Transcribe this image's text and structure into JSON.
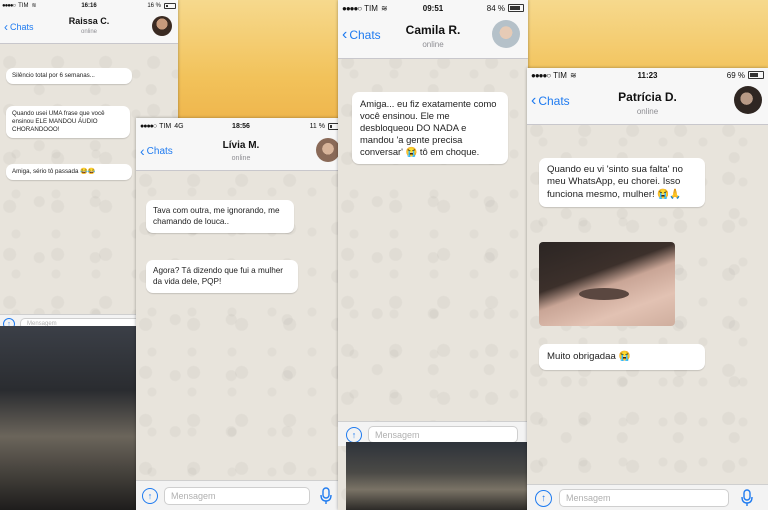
{
  "screens": [
    {
      "status": {
        "carrier": "TIM",
        "time": "16:16",
        "battery": "16 %"
      },
      "nav": {
        "back": "Chats",
        "name": "Raissa C.",
        "status": "online"
      },
      "messages": [
        "Silêncio total por 6 semanas...",
        "Quando usei UMA frase que você ensinou ELE MANDOU ÁUDIO CHORANDOOO!",
        "Amiga, sério tô passada 😂😂"
      ],
      "input_placeholder": "Mensagem"
    },
    {
      "status": {
        "carrier": "TIM",
        "network": "4G",
        "time": "18:56",
        "battery": "11 %"
      },
      "nav": {
        "back": "Chats",
        "name": "Lívia M.",
        "status": "online"
      },
      "messages": [
        "Tava com outra, me ignorando, me chamando de louca..",
        "Agora? Tá dizendo que fui a mulher da vida dele, PQP!"
      ],
      "input_placeholder": "Mensagem"
    },
    {
      "status": {
        "carrier": "TIM",
        "time": "09:51",
        "battery": "84 %"
      },
      "nav": {
        "back": "Chats",
        "name": "Camila R.",
        "status": "online"
      },
      "messages": [
        "Amiga... eu fiz exatamente como você ensinou. Ele me desbloqueou DO NADA e mandou 'a gente precisa conversar' 😭 tô em choque."
      ],
      "input_placeholder": "Mensagem"
    },
    {
      "status": {
        "carrier": "TIM",
        "time": "11:23",
        "battery": "69 %"
      },
      "nav": {
        "back": "Chats",
        "name": "Patrícia D.",
        "status": "online"
      },
      "messages": [
        "Quando eu vi 'sinto sua falta' no meu WhatsApp, eu chorei. Isso funciona mesmo, mulher! 😭🙏",
        "Muito obrigadaa 😭"
      ],
      "input_placeholder": "Mensagem"
    }
  ],
  "colors": {
    "accent": "#1f7bf0",
    "chat_bg": "#e8e4dc",
    "bubble": "#ffffff"
  }
}
